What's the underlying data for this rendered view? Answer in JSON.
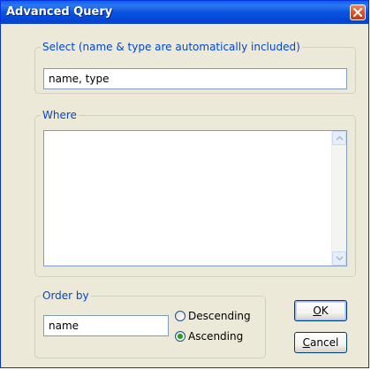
{
  "window": {
    "title": "Advanced Query"
  },
  "select_group": {
    "legend": "Select (name & type are automatically included)",
    "value": "name, type"
  },
  "where_group": {
    "legend": "Where",
    "value": ""
  },
  "order_group": {
    "legend": "Order by",
    "value": "name",
    "options": [
      {
        "label": "Descending",
        "checked": false
      },
      {
        "label": "Ascending",
        "checked": true
      }
    ]
  },
  "buttons": {
    "ok": {
      "mnemonic": "O",
      "rest": "K"
    },
    "cancel": {
      "mnemonic": "C",
      "rest": "ancel"
    }
  },
  "colors": {
    "title_bar": "#0A54E0",
    "dialog_bg": "#ECE9D8",
    "legend_text": "#0046D5",
    "close_button": "#D9542D"
  },
  "icons": {
    "close": "close-x-icon",
    "scroll_up": "scroll-up-arrow-icon",
    "scroll_down": "scroll-down-arrow-icon"
  }
}
